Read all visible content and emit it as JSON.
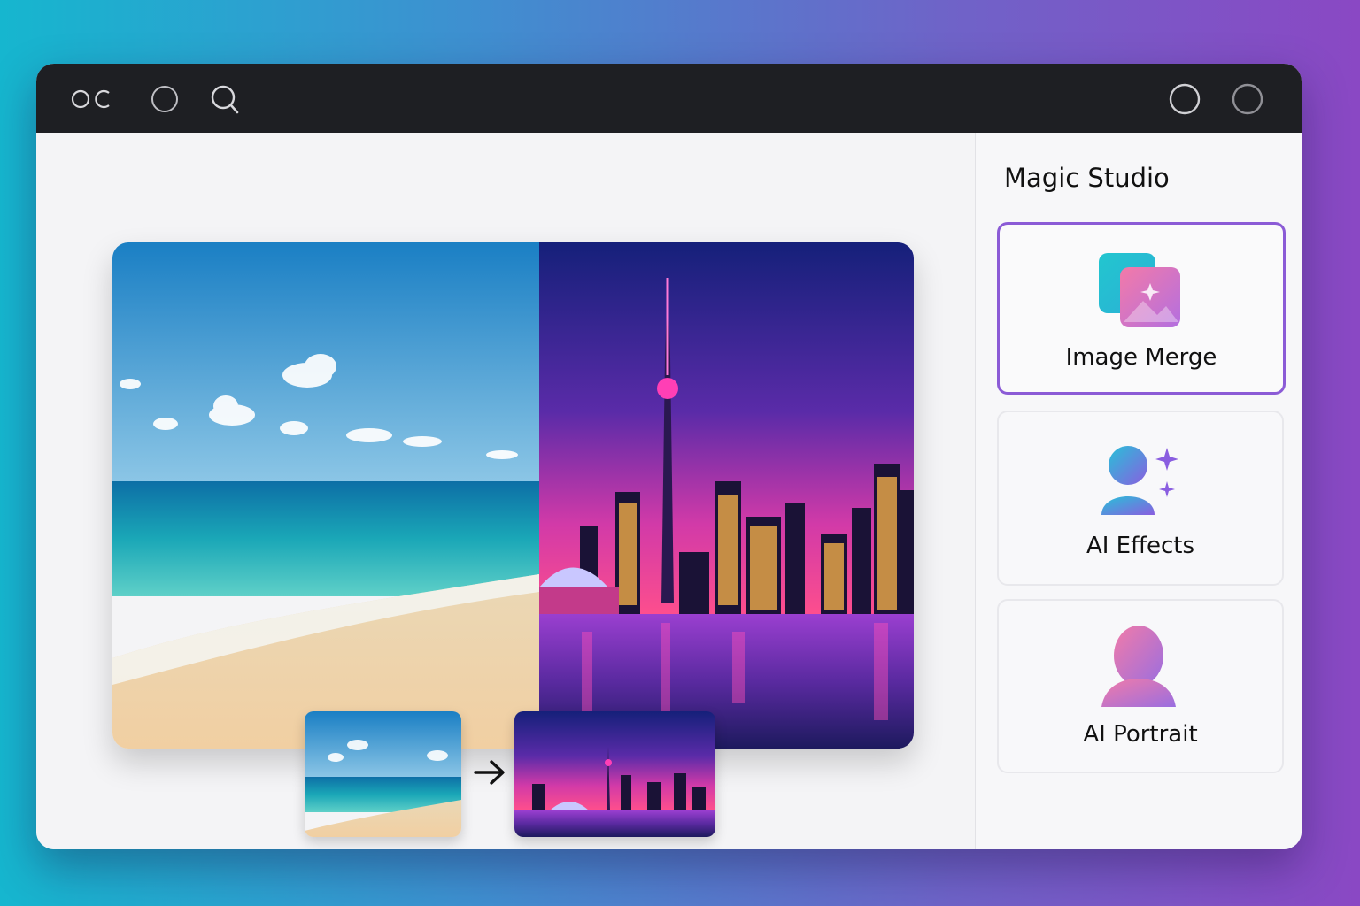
{
  "titlebar": {
    "left_icons": [
      "toggle-icon",
      "circle-icon",
      "search-icon"
    ],
    "right_icons": [
      "circle-icon",
      "circle-icon"
    ]
  },
  "sidebar": {
    "title": "Magic Studio",
    "items": [
      {
        "label": "Image Merge",
        "icon": "image-merge-icon",
        "active": true
      },
      {
        "label": "AI Effects",
        "icon": "ai-effects-icon",
        "active": false
      },
      {
        "label": "AI Portrait",
        "icon": "ai-portrait-icon",
        "active": false
      }
    ]
  },
  "preview": {
    "left_image": "beach-image",
    "right_image": "city-skyline-image"
  },
  "thumbnails": {
    "source": "beach-thumbnail",
    "target": "city-thumbnail",
    "arrow": "arrow-right-icon"
  },
  "colors": {
    "accent": "#8b5bd6",
    "titlebar": "#1e1f23",
    "background_left": "#16b6cf",
    "background_right": "#8a48c4"
  }
}
